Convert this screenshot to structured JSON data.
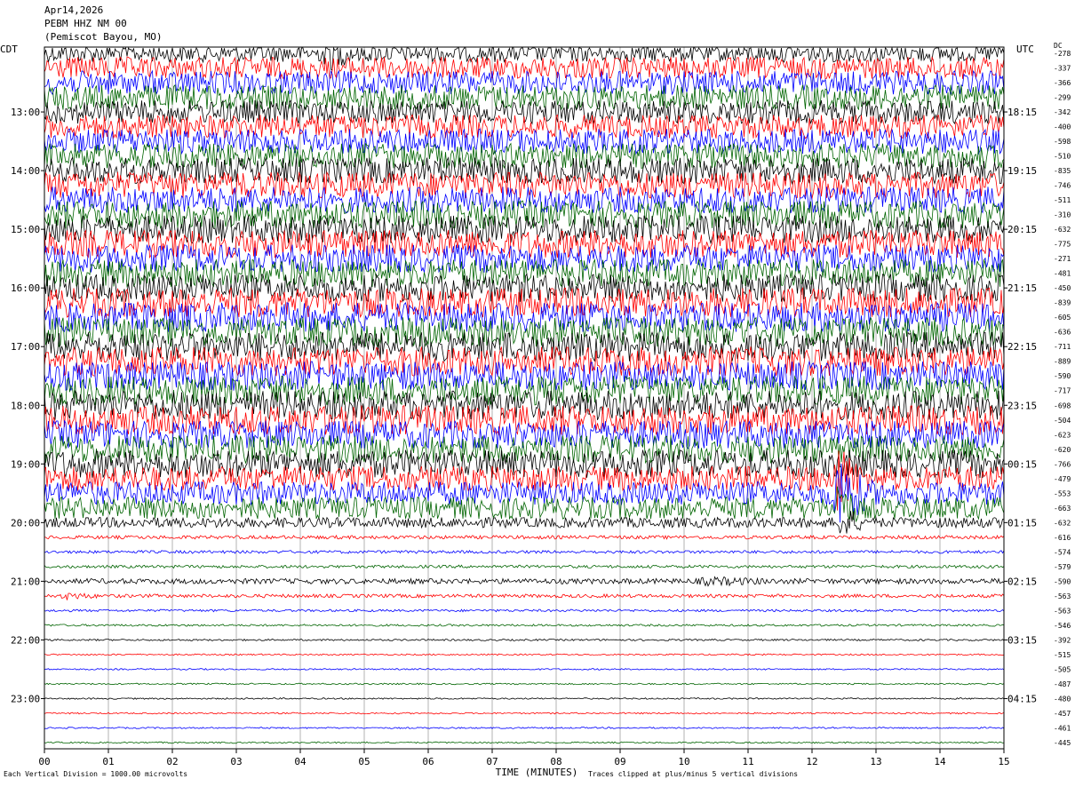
{
  "header": {
    "date": "Apr14,2026",
    "channel": "PEBM HHZ NM 00",
    "location": "(Pemiscot Bayou, MO)"
  },
  "left_axis_label": "CDT",
  "right_axis_label": "UTC",
  "dc_label": "DC",
  "footer": {
    "scale_note": "Each Vertical Division = 1000.00 microvolts",
    "clip_note": "Traces clipped at plus/minus 5 vertical divisions"
  },
  "colors": {
    "black": "#000000",
    "red": "#ff0000",
    "blue": "#0000ff",
    "green": "#006400",
    "grid": "#808080"
  },
  "chart_data": {
    "type": "line",
    "title": "PEBM HHZ NM 00",
    "xlabel": "TIME (MINUTES)",
    "ylabel": "",
    "xlim": [
      0,
      15
    ],
    "x_ticks": [
      "00",
      "01",
      "02",
      "03",
      "04",
      "05",
      "06",
      "07",
      "08",
      "09",
      "10",
      "11",
      "12",
      "13",
      "14",
      "15"
    ],
    "left_ticks": [
      "13:00",
      "14:00",
      "15:00",
      "16:00",
      "17:00",
      "18:00",
      "19:00",
      "20:00",
      "21:00",
      "22:00",
      "23:00"
    ],
    "right_ticks": [
      "18:15",
      "19:15",
      "20:15",
      "21:15",
      "22:15",
      "23:15",
      "00:15",
      "01:15",
      "02:15",
      "03:15",
      "04:15"
    ],
    "trace_count": 48,
    "trace_minutes": 15,
    "color_cycle": [
      "black",
      "red",
      "blue",
      "green"
    ],
    "dc_offsets": [
      "-278",
      "-337",
      "-366",
      "-299",
      "-342",
      "-400",
      "-598",
      "-510",
      "-835",
      "-746",
      "-511",
      "-310",
      "-632",
      "-775",
      "-271",
      "-481",
      "-450",
      "-839",
      "-605",
      "-636",
      "-711",
      "-889",
      "-590",
      "-717",
      "-698",
      "-504",
      "-623",
      "-620",
      "-766",
      "-479",
      "-553",
      "-663",
      "-632",
      "-616",
      "-574",
      "-579",
      "-590",
      "-563",
      "-563",
      "-546",
      "-392",
      "-515",
      "-505",
      "-487",
      "-480",
      "-457",
      "-461",
      "-445"
    ],
    "amplitude_by_trace": [
      0.6,
      0.75,
      0.8,
      0.85,
      0.8,
      0.8,
      0.85,
      0.85,
      0.9,
      0.9,
      0.9,
      0.95,
      0.95,
      0.95,
      0.95,
      0.95,
      0.95,
      1.0,
      1.0,
      1.0,
      1.0,
      1.0,
      1.0,
      1.0,
      1.0,
      1.0,
      0.95,
      0.95,
      0.95,
      0.85,
      0.8,
      0.75,
      0.35,
      0.12,
      0.1,
      0.1,
      0.18,
      0.12,
      0.08,
      0.07,
      0.06,
      0.05,
      0.05,
      0.05,
      0.05,
      0.05,
      0.05,
      0.05
    ],
    "events": [
      {
        "trace": 0,
        "start_min": 4.3,
        "end_min": 5.8,
        "amplitude": 1.8
      },
      {
        "trace": 0,
        "start_min": 10.2,
        "end_min": 10.8,
        "amplitude": 1.2
      },
      {
        "trace": 29,
        "start_min": 12.3,
        "end_min": 13.5,
        "amplitude": 3.5
      },
      {
        "trace": 30,
        "start_min": 12.3,
        "end_min": 13.6,
        "amplitude": 4.0
      },
      {
        "trace": 31,
        "start_min": 12.3,
        "end_min": 13.3,
        "amplitude": 3.0
      },
      {
        "trace": 32,
        "start_min": 12.4,
        "end_min": 13.2,
        "amplitude": 2.0
      },
      {
        "trace": 36,
        "start_min": 10.0,
        "end_min": 15.0,
        "amplitude": 0.45
      },
      {
        "trace": 37,
        "start_min": 0.2,
        "end_min": 2.0,
        "amplitude": 0.4
      }
    ]
  }
}
